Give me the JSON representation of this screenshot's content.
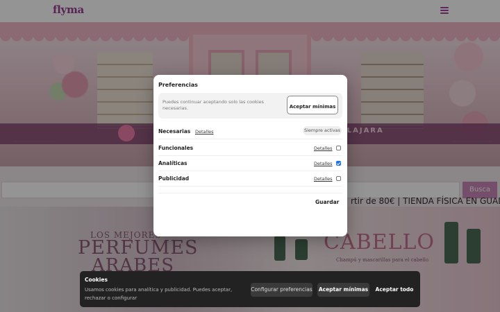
{
  "site": {
    "logo": "flyma",
    "hero_sign": "ALAJARA",
    "search_button": "Busca",
    "ticker": "rtir de 80€ | TIENDA FÍSICA EN GUADALA",
    "banner": {
      "left_line1": "LOS MEJORES",
      "left_line2": "PERFUMES",
      "left_line3": "ARABES",
      "right_title": "CABELLO",
      "right_sub": "Champú y mascarillas para el cabello"
    }
  },
  "preferences": {
    "title": "Preferencias",
    "notice_text": "Puedes continuar aceptando solo las cookies necesarias.",
    "accept_min": "Aceptar mínimas",
    "categories": [
      {
        "label": "Necesarias",
        "details": "Detalles",
        "badge": "Siempre activas",
        "checked": null
      },
      {
        "label": "Funcionales",
        "details": "Detalles",
        "checked": false
      },
      {
        "label": "Analíticas",
        "details": "Detalles",
        "checked": true
      },
      {
        "label": "Publicidad",
        "details": "Detalles",
        "checked": false
      }
    ],
    "save": "Guardar"
  },
  "cookie_bar": {
    "title": "Cookies",
    "text": "Usamos cookies para analítica y publicidad. Puedes aceptar, rechazar o configurar",
    "configure": "Configurar preferencias",
    "accept_min": "Aceptar mínimas",
    "accept_all": "Aceptar todo"
  },
  "colors": {
    "brand": "#9c3d93",
    "checkbox_on": "#1a73e8",
    "cookie_bar_bg": "#222222"
  },
  "icons": {
    "menu": "hamburger-menu-icon",
    "location": "location-pin-icon"
  }
}
